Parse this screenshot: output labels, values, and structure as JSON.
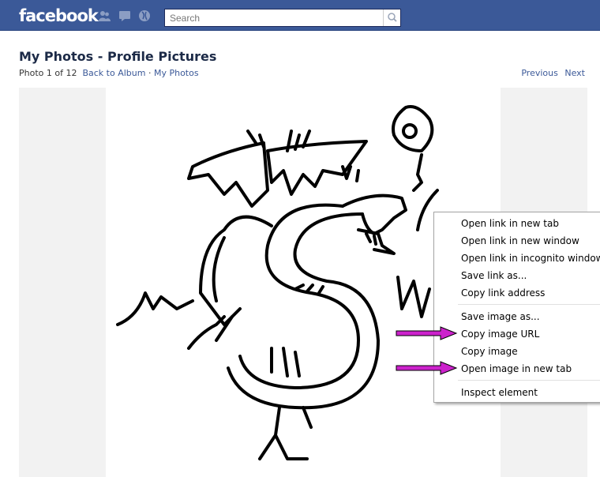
{
  "topbar": {
    "logo": "facebook",
    "icons": [
      "friend-requests-icon",
      "messages-icon",
      "notifications-icon"
    ],
    "search_placeholder": "Search"
  },
  "page": {
    "title": "My Photos - Profile Pictures",
    "photo_counter": "Photo 1 of 12",
    "back_link": "Back to Album",
    "separator": "·",
    "album_link": "My Photos",
    "previous": "Previous",
    "next": "Next"
  },
  "context_menu": {
    "items": [
      "Open link in new tab",
      "Open link in new window",
      "Open link in incognito window",
      "Save link as...",
      "Copy link address",
      "Save image as...",
      "Copy image URL",
      "Copy image",
      "Open image in new tab",
      "Inspect element"
    ]
  },
  "annotations": {
    "arrow_color": "#cc22cc",
    "arrows_point_to": [
      "Copy image URL",
      "Open image in new tab"
    ]
  },
  "colors": {
    "brand_blue": "#3b5998",
    "link": "#3b5998"
  }
}
